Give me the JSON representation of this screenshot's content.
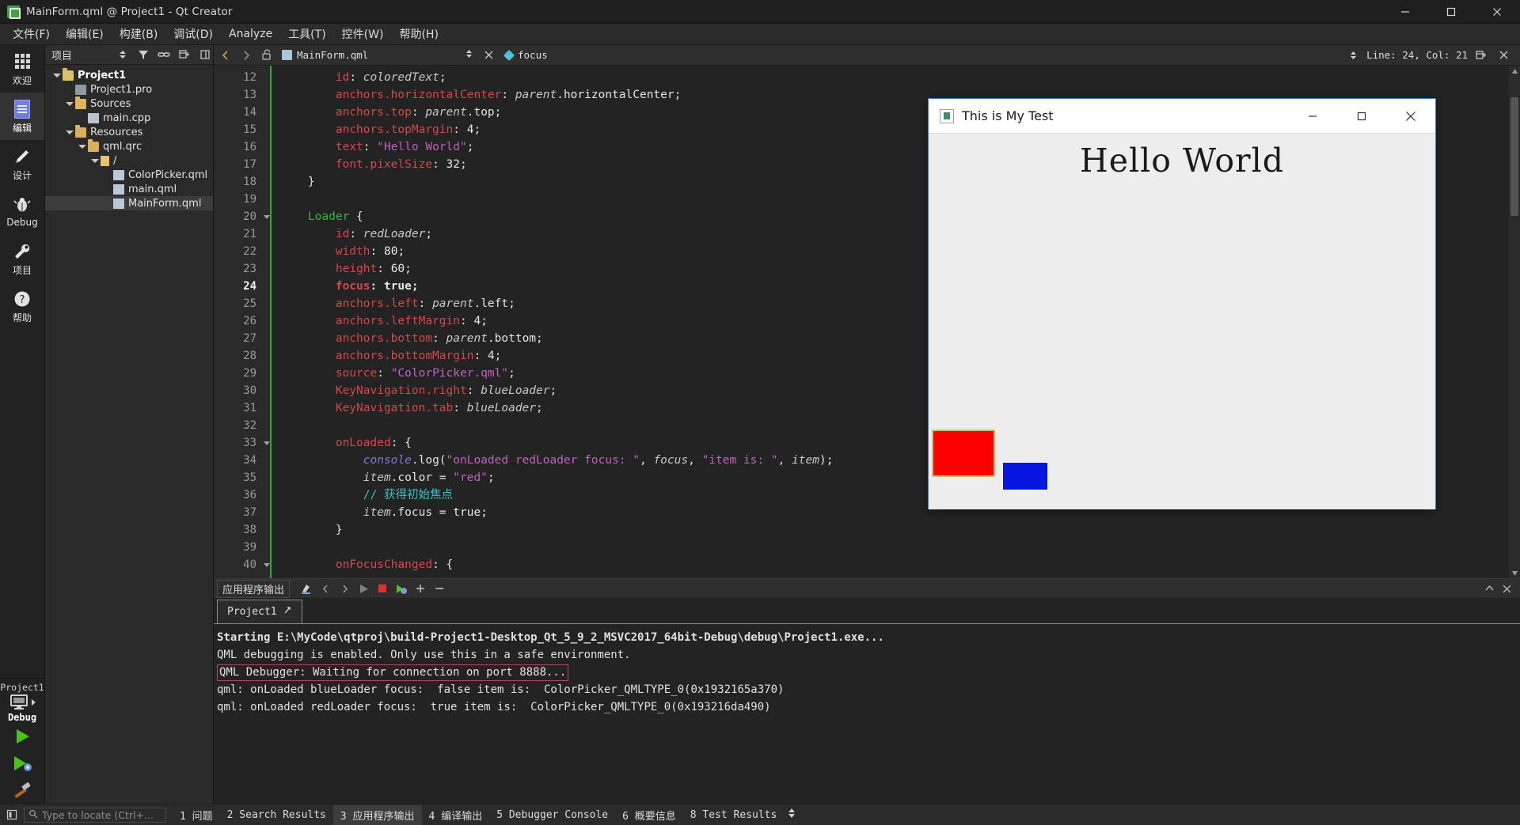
{
  "window": {
    "title": "MainForm.qml @ Project1 - Qt Creator",
    "icon": "qt-creator-icon",
    "minimize": "minimize-icon",
    "maximize": "maximize-icon",
    "close": "close-icon"
  },
  "menubar": {
    "items": [
      {
        "label": "文件(F)",
        "name": "menu-file"
      },
      {
        "label": "编辑(E)",
        "name": "menu-edit"
      },
      {
        "label": "构建(B)",
        "name": "menu-build"
      },
      {
        "label": "调试(D)",
        "name": "menu-debug"
      },
      {
        "label": "Analyze",
        "name": "menu-analyze"
      },
      {
        "label": "工具(T)",
        "name": "menu-tools"
      },
      {
        "label": "控件(W)",
        "name": "menu-window"
      },
      {
        "label": "帮助(H)",
        "name": "menu-help"
      }
    ]
  },
  "modebar": {
    "modes": [
      {
        "label": "欢迎",
        "icon": "grid-dots-icon",
        "active": false
      },
      {
        "label": "编辑",
        "icon": "document-lines-icon",
        "active": true
      },
      {
        "label": "设计",
        "icon": "pencil-icon",
        "active": false
      },
      {
        "label": "Debug",
        "icon": "bug-icon",
        "active": false
      },
      {
        "label": "项目",
        "icon": "wrench-icon",
        "active": false
      },
      {
        "label": "帮助",
        "icon": "question-circle-icon",
        "active": false
      }
    ],
    "kit": {
      "project": "Project1",
      "config": "Debug",
      "icon": "monitor-icon"
    },
    "run_buttons": [
      {
        "name": "run-button",
        "icon": "green-play-icon"
      },
      {
        "name": "debug-button",
        "icon": "green-play-bug-icon"
      },
      {
        "name": "build-button",
        "icon": "hammer-icon"
      }
    ]
  },
  "project_panel": {
    "title": "项目",
    "tools": [
      {
        "name": "filter-icon"
      },
      {
        "name": "link-sync-icon"
      },
      {
        "name": "collapse-all-icon"
      },
      {
        "name": "split-icon"
      }
    ],
    "tree": [
      {
        "label": "Project1",
        "depth": 0,
        "expander": "down",
        "icon": "folder-project",
        "bold": true,
        "selected": false
      },
      {
        "label": "Project1.pro",
        "depth": 1,
        "expander": "none",
        "icon": "file-pro",
        "bold": false,
        "selected": false
      },
      {
        "label": "Sources",
        "depth": 1,
        "expander": "down",
        "icon": "folder-sources",
        "bold": false,
        "selected": false
      },
      {
        "label": "main.cpp",
        "depth": 2,
        "expander": "none",
        "icon": "file-cpp",
        "bold": false,
        "selected": false
      },
      {
        "label": "Resources",
        "depth": 1,
        "expander": "down",
        "icon": "folder-res",
        "bold": false,
        "selected": false
      },
      {
        "label": "qml.qrc",
        "depth": 2,
        "expander": "down",
        "icon": "file-qrc",
        "bold": false,
        "selected": false
      },
      {
        "label": "/",
        "depth": 3,
        "expander": "down",
        "icon": "folder-slash",
        "bold": false,
        "selected": false
      },
      {
        "label": "ColorPicker.qml",
        "depth": 4,
        "expander": "none",
        "icon": "file-qml",
        "bold": false,
        "selected": false
      },
      {
        "label": "main.qml",
        "depth": 4,
        "expander": "none",
        "icon": "file-qml",
        "bold": false,
        "selected": false
      },
      {
        "label": "MainForm.qml",
        "depth": 4,
        "expander": "none",
        "icon": "file-qml",
        "bold": false,
        "selected": true
      }
    ]
  },
  "editor_toolbar": {
    "back": "back-arrow-icon",
    "forward": "forward-arrow-icon",
    "lock": "unlocked-icon",
    "file": "MainForm.qml",
    "file_icon": "qml-file-icon",
    "close_file": "close-icon",
    "symbol": "focus",
    "symbol_icon": "property-diamond-icon",
    "line_col": "Line: 24, Col: 21",
    "split_icon": "split-editor-icon",
    "split_close_icon": "close-split-icon"
  },
  "code": {
    "first_line": 12,
    "current_line": 24,
    "lines": [
      {
        "n": 12,
        "fold": "",
        "tokens": [
          [
            "plain",
            "        "
          ],
          [
            "prop",
            "id"
          ],
          [
            "punc",
            ": "
          ],
          [
            "id",
            "coloredText"
          ],
          [
            "punc",
            ";"
          ]
        ]
      },
      {
        "n": 13,
        "fold": "",
        "tokens": [
          [
            "plain",
            "        "
          ],
          [
            "prop",
            "anchors.horizontalCenter"
          ],
          [
            "punc",
            ": "
          ],
          [
            "id",
            "parent"
          ],
          [
            "plain",
            ".horizontalCenter"
          ],
          [
            "punc",
            ";"
          ]
        ]
      },
      {
        "n": 14,
        "fold": "",
        "tokens": [
          [
            "plain",
            "        "
          ],
          [
            "prop",
            "anchors.top"
          ],
          [
            "punc",
            ": "
          ],
          [
            "id",
            "parent"
          ],
          [
            "plain",
            ".top"
          ],
          [
            "punc",
            ";"
          ]
        ]
      },
      {
        "n": 15,
        "fold": "",
        "tokens": [
          [
            "plain",
            "        "
          ],
          [
            "prop",
            "anchors.topMargin"
          ],
          [
            "punc",
            ": "
          ],
          [
            "num",
            "4"
          ],
          [
            "punc",
            ";"
          ]
        ]
      },
      {
        "n": 16,
        "fold": "",
        "tokens": [
          [
            "plain",
            "        "
          ],
          [
            "prop",
            "text"
          ],
          [
            "punc",
            ": "
          ],
          [
            "str",
            "\"Hello World\""
          ],
          [
            "punc",
            ";"
          ]
        ]
      },
      {
        "n": 17,
        "fold": "",
        "tokens": [
          [
            "plain",
            "        "
          ],
          [
            "prop",
            "font.pixelSize"
          ],
          [
            "punc",
            ": "
          ],
          [
            "num",
            "32"
          ],
          [
            "punc",
            ";"
          ]
        ]
      },
      {
        "n": 18,
        "fold": "",
        "tokens": [
          [
            "plain",
            "    "
          ],
          [
            "punc",
            "}"
          ]
        ]
      },
      {
        "n": 19,
        "fold": "",
        "tokens": []
      },
      {
        "n": 20,
        "fold": "down",
        "tokens": [
          [
            "plain",
            "    "
          ],
          [
            "type",
            "Loader"
          ],
          [
            "punc",
            " {"
          ]
        ]
      },
      {
        "n": 21,
        "fold": "",
        "tokens": [
          [
            "plain",
            "        "
          ],
          [
            "prop",
            "id"
          ],
          [
            "punc",
            ": "
          ],
          [
            "id",
            "redLoader"
          ],
          [
            "punc",
            ";"
          ]
        ]
      },
      {
        "n": 22,
        "fold": "",
        "tokens": [
          [
            "plain",
            "        "
          ],
          [
            "prop",
            "width"
          ],
          [
            "punc",
            ": "
          ],
          [
            "num",
            "80"
          ],
          [
            "punc",
            ";"
          ]
        ]
      },
      {
        "n": 23,
        "fold": "",
        "tokens": [
          [
            "plain",
            "        "
          ],
          [
            "prop",
            "height"
          ],
          [
            "punc",
            ": "
          ],
          [
            "num",
            "60"
          ],
          [
            "punc",
            ";"
          ]
        ]
      },
      {
        "n": 24,
        "fold": "",
        "tokens": [
          [
            "plain",
            "        "
          ],
          [
            "prop",
            "focus"
          ],
          [
            "punc",
            ": "
          ],
          [
            "num",
            "true"
          ],
          [
            "punc",
            ";"
          ]
        ]
      },
      {
        "n": 25,
        "fold": "",
        "tokens": [
          [
            "plain",
            "        "
          ],
          [
            "prop",
            "anchors.left"
          ],
          [
            "punc",
            ": "
          ],
          [
            "id",
            "parent"
          ],
          [
            "plain",
            ".left"
          ],
          [
            "punc",
            ";"
          ]
        ]
      },
      {
        "n": 26,
        "fold": "",
        "tokens": [
          [
            "plain",
            "        "
          ],
          [
            "prop",
            "anchors.leftMargin"
          ],
          [
            "punc",
            ": "
          ],
          [
            "num",
            "4"
          ],
          [
            "punc",
            ";"
          ]
        ]
      },
      {
        "n": 27,
        "fold": "",
        "tokens": [
          [
            "plain",
            "        "
          ],
          [
            "prop",
            "anchors.bottom"
          ],
          [
            "punc",
            ": "
          ],
          [
            "id",
            "parent"
          ],
          [
            "plain",
            ".bottom"
          ],
          [
            "punc",
            ";"
          ]
        ]
      },
      {
        "n": 28,
        "fold": "",
        "tokens": [
          [
            "plain",
            "        "
          ],
          [
            "prop",
            "anchors.bottomMargin"
          ],
          [
            "punc",
            ": "
          ],
          [
            "num",
            "4"
          ],
          [
            "punc",
            ";"
          ]
        ]
      },
      {
        "n": 29,
        "fold": "",
        "tokens": [
          [
            "plain",
            "        "
          ],
          [
            "prop",
            "source"
          ],
          [
            "punc",
            ": "
          ],
          [
            "str",
            "\"ColorPicker.qml\""
          ],
          [
            "punc",
            ";"
          ]
        ]
      },
      {
        "n": 30,
        "fold": "",
        "tokens": [
          [
            "plain",
            "        "
          ],
          [
            "prop",
            "KeyNavigation.right"
          ],
          [
            "punc",
            ": "
          ],
          [
            "id",
            "blueLoader"
          ],
          [
            "punc",
            ";"
          ]
        ]
      },
      {
        "n": 31,
        "fold": "",
        "tokens": [
          [
            "plain",
            "        "
          ],
          [
            "prop",
            "KeyNavigation.tab"
          ],
          [
            "punc",
            ": "
          ],
          [
            "id",
            "blueLoader"
          ],
          [
            "punc",
            ";"
          ]
        ]
      },
      {
        "n": 32,
        "fold": "",
        "tokens": []
      },
      {
        "n": 33,
        "fold": "down",
        "tokens": [
          [
            "plain",
            "        "
          ],
          [
            "prop",
            "onLoaded"
          ],
          [
            "punc",
            ": {"
          ]
        ]
      },
      {
        "n": 34,
        "fold": "",
        "tokens": [
          [
            "plain",
            "            "
          ],
          [
            "obj",
            "console"
          ],
          [
            "plain",
            ".log("
          ],
          [
            "str",
            "\"onLoaded redLoader focus: \""
          ],
          [
            "plain",
            ", "
          ],
          [
            "id",
            "focus"
          ],
          [
            "plain",
            ", "
          ],
          [
            "str",
            "\"item is: \""
          ],
          [
            "plain",
            ", "
          ],
          [
            "id",
            "item"
          ],
          [
            "plain",
            ");"
          ]
        ]
      },
      {
        "n": 35,
        "fold": "",
        "tokens": [
          [
            "plain",
            "            "
          ],
          [
            "id",
            "item"
          ],
          [
            "plain",
            ".color = "
          ],
          [
            "str",
            "\"red\""
          ],
          [
            "punc",
            ";"
          ]
        ]
      },
      {
        "n": 36,
        "fold": "",
        "tokens": [
          [
            "plain",
            "            "
          ],
          [
            "cmt",
            "// 获得初始焦点"
          ]
        ]
      },
      {
        "n": 37,
        "fold": "",
        "tokens": [
          [
            "plain",
            "            "
          ],
          [
            "id",
            "item"
          ],
          [
            "plain",
            ".focus = "
          ],
          [
            "num",
            "true"
          ],
          [
            "punc",
            ";"
          ]
        ]
      },
      {
        "n": 38,
        "fold": "",
        "tokens": [
          [
            "plain",
            "        "
          ],
          [
            "punc",
            "}"
          ]
        ]
      },
      {
        "n": 39,
        "fold": "",
        "tokens": []
      },
      {
        "n": 40,
        "fold": "down",
        "tokens": [
          [
            "plain",
            "        "
          ],
          [
            "prop",
            "onFocusChanged"
          ],
          [
            "punc",
            ": {"
          ]
        ]
      }
    ]
  },
  "output_pane": {
    "title": "应用程序输出",
    "toolbar_icons": [
      {
        "name": "clear-output-icon"
      },
      {
        "name": "prev-item-icon"
      },
      {
        "name": "next-item-icon"
      },
      {
        "name": "run-app-icon"
      },
      {
        "name": "stop-app-icon"
      },
      {
        "name": "attach-debugger-icon"
      },
      {
        "name": "zoom-in-icon"
      },
      {
        "name": "zoom-out-icon"
      }
    ],
    "right_icons": [
      {
        "name": "maximize-pane-icon"
      },
      {
        "name": "close-pane-icon"
      }
    ],
    "tabs": [
      {
        "label": "Project1",
        "icon": "running-icon",
        "active": true
      }
    ],
    "lines": [
      {
        "text": "Starting E:\\MyCode\\qtproj\\build-Project1-Desktop_Qt_5_9_2_MSVC2017_64bit-Debug\\debug\\Project1.exe...",
        "style": "bold"
      },
      {
        "text": "QML debugging is enabled. Only use this in a safe environment.",
        "style": "normal"
      },
      {
        "text": "QML Debugger: Waiting for connection on port 8888...",
        "style": "marked"
      },
      {
        "text": "qml: onLoaded blueLoader focus:  false item is:  ColorPicker_QMLTYPE_0(0x1932165a370)",
        "style": "normal"
      },
      {
        "text": "qml: onLoaded redLoader focus:  true item is:  ColorPicker_QMLTYPE_0(0x193216da490)",
        "style": "normal"
      }
    ]
  },
  "statusbar": {
    "sidebar_toggle": "sidebar-toggle-icon",
    "locator_placeholder": "Type to locate (Ctrl+...",
    "locator_icon": "search-icon",
    "items": [
      {
        "label": "1 问题",
        "active": false
      },
      {
        "label": "2 Search Results",
        "active": false
      },
      {
        "label": "3 应用程序输出",
        "active": true
      },
      {
        "label": "4 编译输出",
        "active": false
      },
      {
        "label": "5 Debugger Console",
        "active": false
      },
      {
        "label": "6 概要信息",
        "active": false
      },
      {
        "label": "8 Test Results",
        "active": false
      }
    ],
    "updown_icon": "up-down-arrows-icon"
  },
  "qml_window": {
    "title": "This is My Test",
    "icon": "qml-app-icon",
    "minimize": "minimize-icon",
    "maximize": "maximize-icon",
    "close": "close-icon",
    "hello_text": "Hello World",
    "rects": [
      {
        "name": "red-rect",
        "color": "#fe0000",
        "border": "#c9c36a",
        "focused": true
      },
      {
        "name": "blue-rect",
        "color": "#0716e0",
        "border": "#f2f2f2",
        "focused": false
      }
    ]
  },
  "colors": {
    "accent_green": "#23b223",
    "property_red": "#d2494a",
    "type_green": "#3bb33b",
    "string_purple": "#c061c0",
    "comment_cyan": "#3bc2c2",
    "object_blue": "#7b7bdb"
  }
}
